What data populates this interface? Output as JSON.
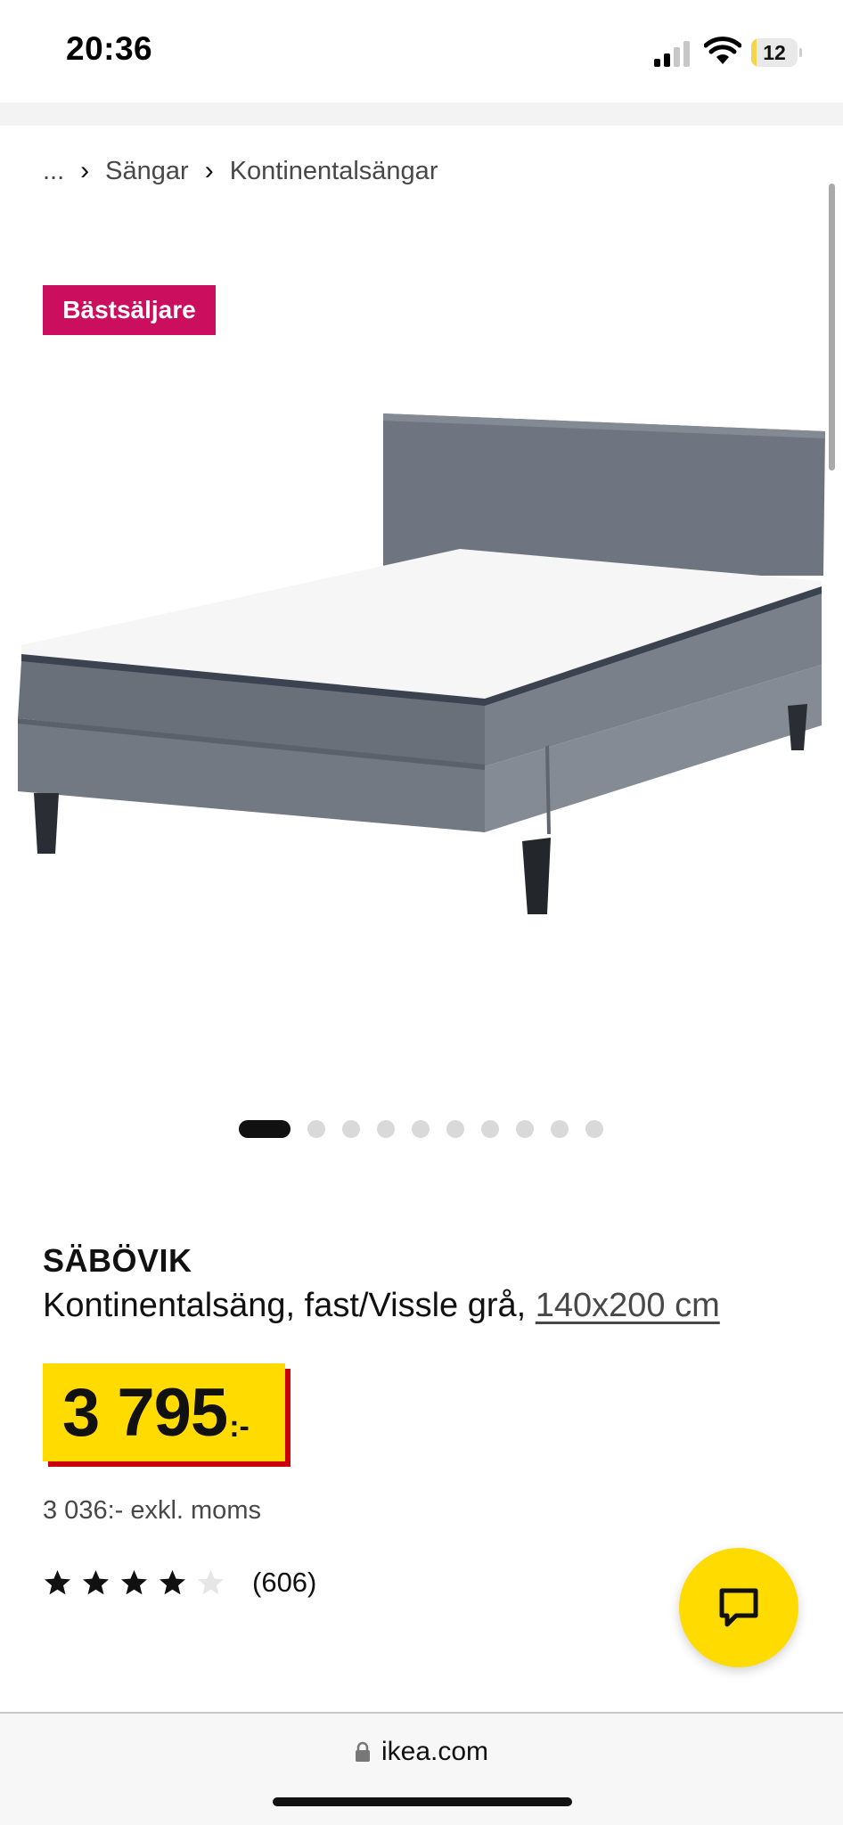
{
  "status_bar": {
    "time": "20:36",
    "battery_level": "12",
    "battery_percent": 0.12,
    "icons": [
      "signal-icon",
      "wifi-icon",
      "battery-icon"
    ]
  },
  "breadcrumb": {
    "ellipsis": "...",
    "items": [
      "Sängar",
      "Kontinentalsängar"
    ]
  },
  "badge": {
    "label": "Bästsäljare",
    "color": "#cc0e5e"
  },
  "carousel": {
    "total_images": 10,
    "active_index": 0
  },
  "product": {
    "name": "SÄBÖVIK",
    "description": "Kontinentalsäng, fast/Vissle grå, ",
    "size_link": "140x200 cm",
    "price": "3 795",
    "price_suffix": ":-",
    "price_excl_vat": "3 036:- exkl. moms",
    "rating": 4,
    "rating_max": 5,
    "review_count": "(606)"
  },
  "colors": {
    "price_yellow": "#ffdb00",
    "price_shadow_red": "#cc0008",
    "chat_yellow": "#ffdb00"
  },
  "chat": {
    "icon": "chat-icon"
  },
  "browser": {
    "url": "ikea.com",
    "icon": "lock-icon"
  }
}
